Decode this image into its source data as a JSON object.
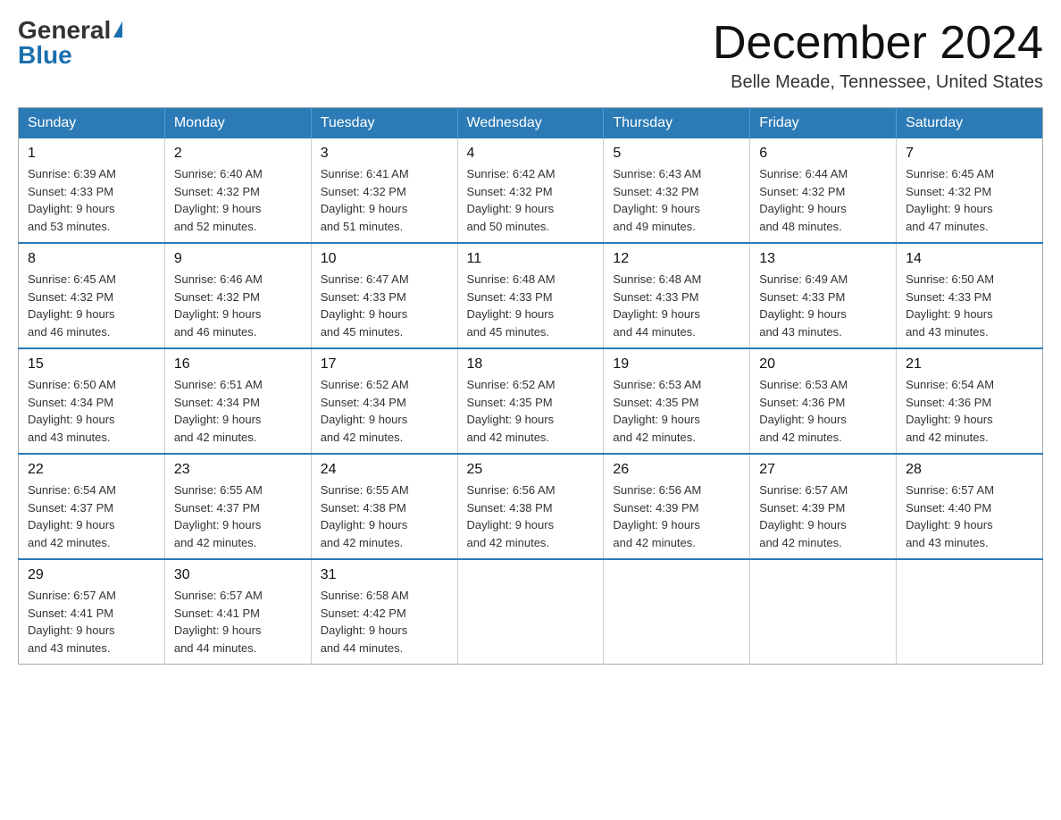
{
  "logo": {
    "general": "General",
    "blue": "Blue"
  },
  "header": {
    "month": "December 2024",
    "location": "Belle Meade, Tennessee, United States"
  },
  "weekdays": [
    "Sunday",
    "Monday",
    "Tuesday",
    "Wednesday",
    "Thursday",
    "Friday",
    "Saturday"
  ],
  "weeks": [
    [
      {
        "day": "1",
        "sunrise": "6:39 AM",
        "sunset": "4:33 PM",
        "daylight": "9 hours and 53 minutes."
      },
      {
        "day": "2",
        "sunrise": "6:40 AM",
        "sunset": "4:32 PM",
        "daylight": "9 hours and 52 minutes."
      },
      {
        "day": "3",
        "sunrise": "6:41 AM",
        "sunset": "4:32 PM",
        "daylight": "9 hours and 51 minutes."
      },
      {
        "day": "4",
        "sunrise": "6:42 AM",
        "sunset": "4:32 PM",
        "daylight": "9 hours and 50 minutes."
      },
      {
        "day": "5",
        "sunrise": "6:43 AM",
        "sunset": "4:32 PM",
        "daylight": "9 hours and 49 minutes."
      },
      {
        "day": "6",
        "sunrise": "6:44 AM",
        "sunset": "4:32 PM",
        "daylight": "9 hours and 48 minutes."
      },
      {
        "day": "7",
        "sunrise": "6:45 AM",
        "sunset": "4:32 PM",
        "daylight": "9 hours and 47 minutes."
      }
    ],
    [
      {
        "day": "8",
        "sunrise": "6:45 AM",
        "sunset": "4:32 PM",
        "daylight": "9 hours and 46 minutes."
      },
      {
        "day": "9",
        "sunrise": "6:46 AM",
        "sunset": "4:32 PM",
        "daylight": "9 hours and 46 minutes."
      },
      {
        "day": "10",
        "sunrise": "6:47 AM",
        "sunset": "4:33 PM",
        "daylight": "9 hours and 45 minutes."
      },
      {
        "day": "11",
        "sunrise": "6:48 AM",
        "sunset": "4:33 PM",
        "daylight": "9 hours and 45 minutes."
      },
      {
        "day": "12",
        "sunrise": "6:48 AM",
        "sunset": "4:33 PM",
        "daylight": "9 hours and 44 minutes."
      },
      {
        "day": "13",
        "sunrise": "6:49 AM",
        "sunset": "4:33 PM",
        "daylight": "9 hours and 43 minutes."
      },
      {
        "day": "14",
        "sunrise": "6:50 AM",
        "sunset": "4:33 PM",
        "daylight": "9 hours and 43 minutes."
      }
    ],
    [
      {
        "day": "15",
        "sunrise": "6:50 AM",
        "sunset": "4:34 PM",
        "daylight": "9 hours and 43 minutes."
      },
      {
        "day": "16",
        "sunrise": "6:51 AM",
        "sunset": "4:34 PM",
        "daylight": "9 hours and 42 minutes."
      },
      {
        "day": "17",
        "sunrise": "6:52 AM",
        "sunset": "4:34 PM",
        "daylight": "9 hours and 42 minutes."
      },
      {
        "day": "18",
        "sunrise": "6:52 AM",
        "sunset": "4:35 PM",
        "daylight": "9 hours and 42 minutes."
      },
      {
        "day": "19",
        "sunrise": "6:53 AM",
        "sunset": "4:35 PM",
        "daylight": "9 hours and 42 minutes."
      },
      {
        "day": "20",
        "sunrise": "6:53 AM",
        "sunset": "4:36 PM",
        "daylight": "9 hours and 42 minutes."
      },
      {
        "day": "21",
        "sunrise": "6:54 AM",
        "sunset": "4:36 PM",
        "daylight": "9 hours and 42 minutes."
      }
    ],
    [
      {
        "day": "22",
        "sunrise": "6:54 AM",
        "sunset": "4:37 PM",
        "daylight": "9 hours and 42 minutes."
      },
      {
        "day": "23",
        "sunrise": "6:55 AM",
        "sunset": "4:37 PM",
        "daylight": "9 hours and 42 minutes."
      },
      {
        "day": "24",
        "sunrise": "6:55 AM",
        "sunset": "4:38 PM",
        "daylight": "9 hours and 42 minutes."
      },
      {
        "day": "25",
        "sunrise": "6:56 AM",
        "sunset": "4:38 PM",
        "daylight": "9 hours and 42 minutes."
      },
      {
        "day": "26",
        "sunrise": "6:56 AM",
        "sunset": "4:39 PM",
        "daylight": "9 hours and 42 minutes."
      },
      {
        "day": "27",
        "sunrise": "6:57 AM",
        "sunset": "4:39 PM",
        "daylight": "9 hours and 42 minutes."
      },
      {
        "day": "28",
        "sunrise": "6:57 AM",
        "sunset": "4:40 PM",
        "daylight": "9 hours and 43 minutes."
      }
    ],
    [
      {
        "day": "29",
        "sunrise": "6:57 AM",
        "sunset": "4:41 PM",
        "daylight": "9 hours and 43 minutes."
      },
      {
        "day": "30",
        "sunrise": "6:57 AM",
        "sunset": "4:41 PM",
        "daylight": "9 hours and 44 minutes."
      },
      {
        "day": "31",
        "sunrise": "6:58 AM",
        "sunset": "4:42 PM",
        "daylight": "9 hours and 44 minutes."
      },
      null,
      null,
      null,
      null
    ]
  ],
  "labels": {
    "sunrise": "Sunrise:",
    "sunset": "Sunset:",
    "daylight": "Daylight:"
  }
}
